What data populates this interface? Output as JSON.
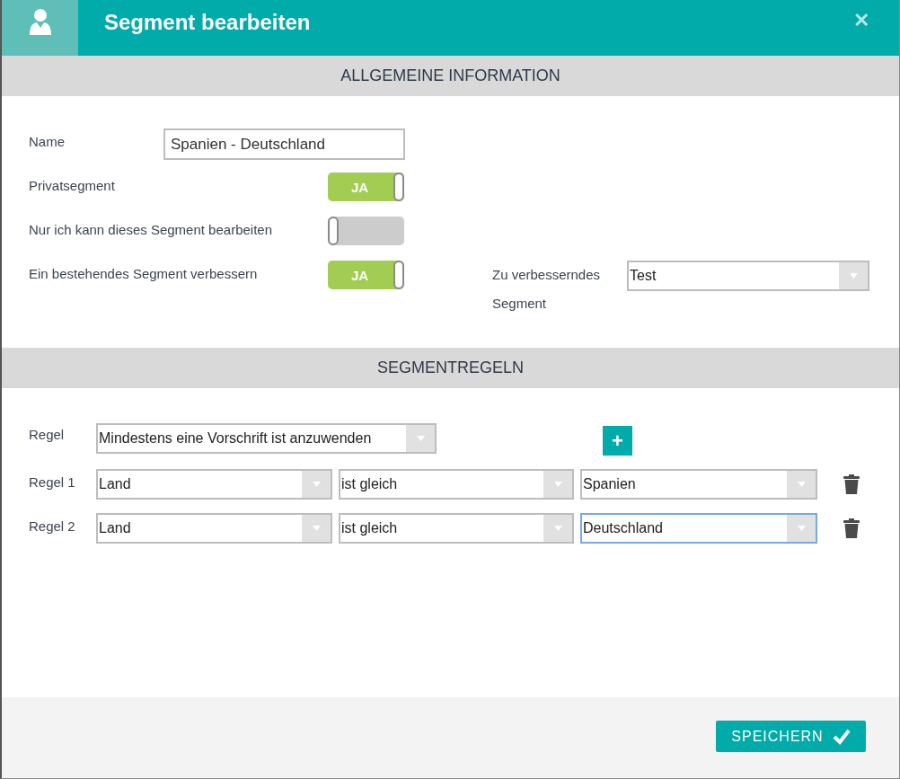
{
  "window": {
    "title": "Segment bearbeiten",
    "close": "✕"
  },
  "general": {
    "heading": "ALLGEMEINE INFORMATION",
    "name": {
      "label": "Name",
      "value": "Spanien - Deutschland"
    },
    "toggles": [
      {
        "label": "Privatsegment",
        "on": true,
        "text": "JA"
      },
      {
        "label": "Nur ich kann dieses Segment bearbeiten",
        "on": false
      },
      {
        "label": "Ein bestehendes Segment verbessern",
        "on": true,
        "text": "JA"
      }
    ],
    "improve": {
      "label": "Zu verbesserndes Segment",
      "value": "Test"
    }
  },
  "rules": {
    "heading": "SEGMENTREGELN",
    "mode": {
      "label": "Regel",
      "value": "Mindestens eine Vorschrift ist anzuwenden"
    },
    "add": "+",
    "rows": [
      {
        "label": "Regel 1",
        "field": "Land",
        "operator": "ist gleich",
        "value": "Spanien",
        "focused": false
      },
      {
        "label": "Regel 2",
        "field": "Land",
        "operator": "ist gleich",
        "value": "Deutschland",
        "focused": true
      }
    ]
  },
  "footer": {
    "save": "SPEICHERN"
  }
}
